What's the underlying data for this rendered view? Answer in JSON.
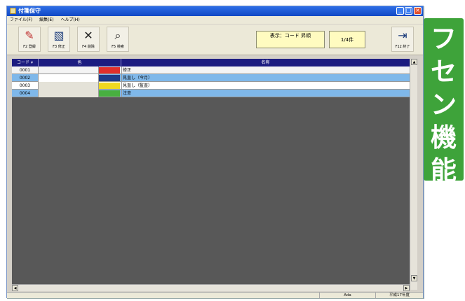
{
  "window": {
    "title": "付箋保守",
    "controls": {
      "min": "_",
      "max": "□",
      "close": "×"
    }
  },
  "menu": [
    "ファイル(F)",
    "編集(E)",
    "ヘルプ(H)"
  ],
  "toolbar": {
    "register": "F2 登録",
    "modify": "F3 修正",
    "delete": "F4 削除",
    "search": "F5 検索",
    "exit": "F12 終了",
    "display": "表示：コード 昇順",
    "count": "1/4件"
  },
  "grid": {
    "headers": {
      "code": "コード",
      "color": "色",
      "name": "名称"
    },
    "rows": [
      {
        "code": "0001",
        "color": "#e02f2c",
        "name": "修正",
        "bg": "#f4f4f4"
      },
      {
        "code": "0002",
        "color": "#1d3c8a",
        "name": "見直し（今月）",
        "bg": "#7fb8ea"
      },
      {
        "code": "0003",
        "color": "#f0d820",
        "name": "見直し（監査）",
        "bg": "#ffffff"
      },
      {
        "code": "0004",
        "color": "#48b040",
        "name": "注意",
        "bg": "#7fb8ea"
      }
    ]
  },
  "status": {
    "user": "Ada",
    "date": "平成17年度"
  },
  "banner": {
    "chars": [
      "フ",
      "セ",
      "ン",
      "機",
      "能"
    ]
  }
}
